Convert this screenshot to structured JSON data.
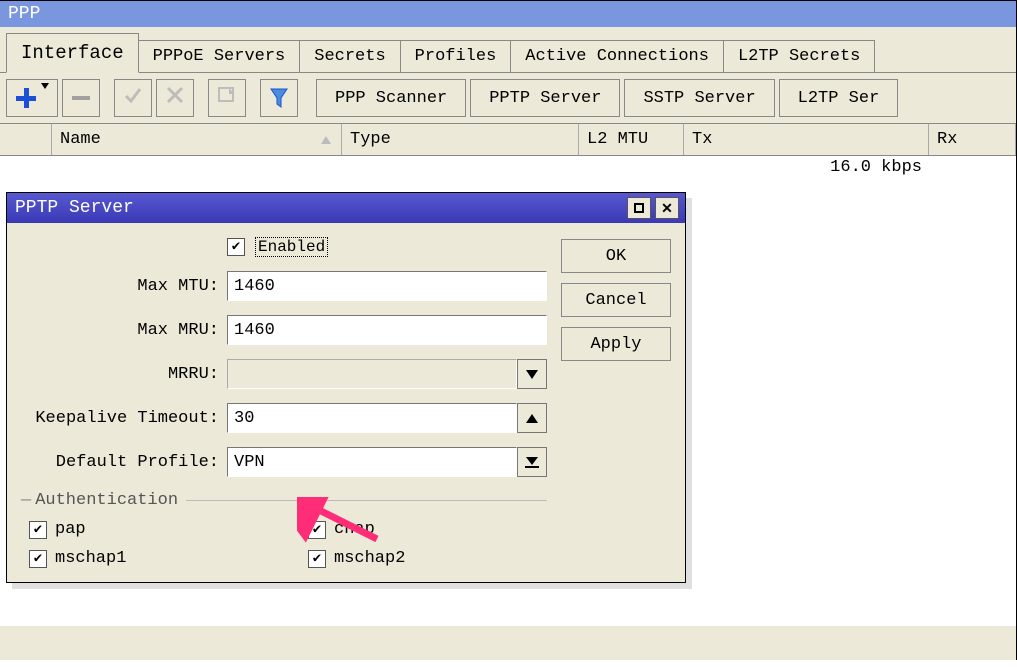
{
  "window": {
    "title": "PPP"
  },
  "tabs": {
    "interface": "Interface",
    "pppoe_servers": "PPPoE Servers",
    "secrets": "Secrets",
    "profiles": "Profiles",
    "active_connections": "Active Connections",
    "l2tp_secrets": "L2TP Secrets"
  },
  "toolbar": {
    "ppp_scanner": "PPP Scanner",
    "pptp_server": "PPTP Server",
    "sstp_server": "SSTP Server",
    "l2tp_server": "L2TP Ser"
  },
  "columns": {
    "name": "Name",
    "type": "Type",
    "l2mtu": "L2 MTU",
    "tx": "Tx",
    "rx": "Rx"
  },
  "row0": {
    "tx": "16.0 kbps"
  },
  "dialog": {
    "title": "PPTP Server",
    "enabled_label": "Enabled",
    "max_mtu_label": "Max MTU:",
    "max_mtu_value": "1460",
    "max_mru_label": "Max MRU:",
    "max_mru_value": "1460",
    "mrru_label": "MRRU:",
    "mrru_value": "",
    "keepalive_label": "Keepalive Timeout:",
    "keepalive_value": "30",
    "default_profile_label": "Default Profile:",
    "default_profile_value": "VPN",
    "auth_group": "Authentication",
    "auth_pap": "pap",
    "auth_chap": "chap",
    "auth_mschap1": "mschap1",
    "auth_mschap2": "mschap2",
    "ok": "OK",
    "cancel": "Cancel",
    "apply": "Apply"
  }
}
